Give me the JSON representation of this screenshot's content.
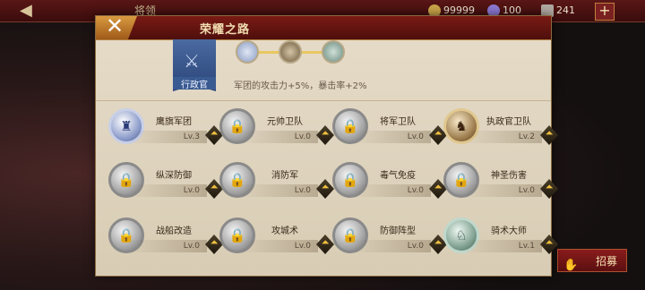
{
  "topbar": {
    "title": "将领",
    "resources": [
      {
        "icon": "gold-coin-icon",
        "value": "99999"
      },
      {
        "icon": "gem-icon",
        "value": "100"
      },
      {
        "icon": "crown-icon",
        "value": "241"
      }
    ],
    "add_label": "+"
  },
  "recruit_label": "招募",
  "panel": {
    "close_label": "✕",
    "title": "荣耀之路",
    "rank": "行政官",
    "bonus": "军团的攻击力+5%，暴击率+2%"
  },
  "techs": [
    {
      "name": "鹰旗军团",
      "level": "Lv.3",
      "icon": "eagle-banner-icon",
      "state": "lit-blue"
    },
    {
      "name": "元帅卫队",
      "level": "Lv.0",
      "icon": "lock-icon",
      "state": "locked"
    },
    {
      "name": "将军卫队",
      "level": "Lv.0",
      "icon": "lock-icon",
      "state": "locked"
    },
    {
      "name": "执政官卫队",
      "level": "Lv.2",
      "icon": "shield-horse-icon",
      "state": "lit-gold"
    },
    {
      "name": "纵深防御",
      "level": "Lv.0",
      "icon": "lock-icon",
      "state": "locked"
    },
    {
      "name": "消防军",
      "level": "Lv.0",
      "icon": "lock-icon",
      "state": "locked"
    },
    {
      "name": "毒气免疫",
      "level": "Lv.0",
      "icon": "lock-icon",
      "state": "locked"
    },
    {
      "name": "神圣伤害",
      "level": "Lv.0",
      "icon": "lock-icon",
      "state": "locked"
    },
    {
      "name": "战船改造",
      "level": "Lv.0",
      "icon": "lock-icon",
      "state": "locked"
    },
    {
      "name": "攻城术",
      "level": "Lv.0",
      "icon": "lock-icon",
      "state": "locked"
    },
    {
      "name": "防御阵型",
      "level": "Lv.0",
      "icon": "lock-icon",
      "state": "locked"
    },
    {
      "name": "骑术大师",
      "level": "Lv.1",
      "icon": "horse-head-icon",
      "state": "lit-green"
    }
  ]
}
